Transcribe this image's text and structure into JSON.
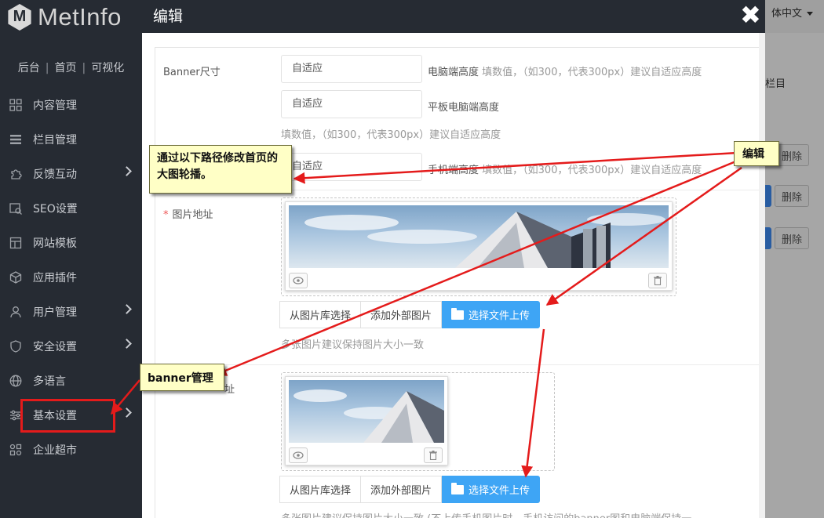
{
  "sidebar": {
    "logo_text": "MetInfo",
    "top_links": [
      "后台",
      "首页",
      "可视化"
    ],
    "top_sep": "|",
    "items": [
      {
        "label": "内容管理",
        "icon": "grid-icon",
        "arrow": false
      },
      {
        "label": "栏目管理",
        "icon": "list-icon",
        "arrow": false
      },
      {
        "label": "反馈互动",
        "icon": "puzzle-icon",
        "arrow": true
      },
      {
        "label": "SEO设置",
        "icon": "seo-icon",
        "arrow": false
      },
      {
        "label": "网站模板",
        "icon": "template-icon",
        "arrow": false
      },
      {
        "label": "应用插件",
        "icon": "cube-icon",
        "arrow": false
      },
      {
        "label": "用户管理",
        "icon": "user-icon",
        "arrow": true
      },
      {
        "label": "安全设置",
        "icon": "shield-icon",
        "arrow": true
      },
      {
        "label": "多语言",
        "icon": "globe-icon",
        "arrow": false
      },
      {
        "label": "基本设置",
        "icon": "sliders-icon",
        "arrow": true
      },
      {
        "label": "企业超市",
        "icon": "apps-icon",
        "arrow": false
      }
    ]
  },
  "background_page": {
    "language": "体中文",
    "column_label": "栏目",
    "delete_label": "删除"
  },
  "modal": {
    "title": "编辑",
    "close_glyph": "✖",
    "banner_size_label": "Banner尺寸",
    "pc_height_value": "自适应",
    "pc_height_label": "电脑端高度",
    "pc_height_hint": "填数值，（如300，代表300px）建议自适应高度",
    "tablet_height_value": "自适应",
    "tablet_height_label": "平板电脑端高度",
    "tablet_height_hint": "填数值，（如300，代表300px）建议自适应高度",
    "mobile_height_value": "自适应",
    "mobile_height_label": "手机端高度",
    "mobile_height_hint": "填数值，（如300，代表300px）建议自适应高度",
    "required_mark": "*",
    "image_url_label": "图片地址",
    "image_url2_label": "址",
    "btn_library": "从图片库选择",
    "btn_external": "添加外部图片",
    "btn_upload": "选择文件上传",
    "image_hint": "多张图片建议保持图片大小一致",
    "image_hint2": "多张图片建议保持图片大小一致 (不上传手机图片时，手机访问的banner图和电脑端保持一"
  },
  "callouts": {
    "path_note": "通过以下路径修改首页的大图轮播。",
    "edit_note": "编辑",
    "banner_note": "banner管理"
  },
  "colors": {
    "sidebar_bg": "#262b33",
    "primary_button": "#3ea5f5",
    "callout_bg": "#ffffc6",
    "annotation_red": "#e41b1b"
  }
}
